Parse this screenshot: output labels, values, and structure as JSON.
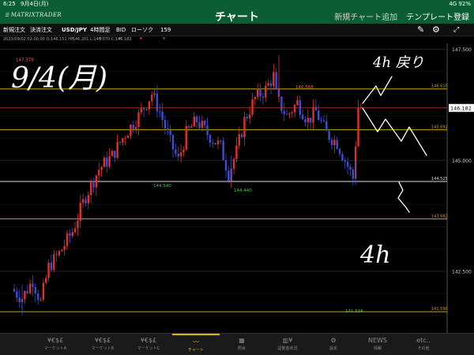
{
  "status": {
    "time": "6:25",
    "date": "9月4日(月)",
    "signal": "4G 92%"
  },
  "app": {
    "logo": "MATRIXTRADER",
    "title": "チャート",
    "add_chart": "新規チャート追加",
    "template": "テンプレート登録"
  },
  "toolbar": {
    "new_order": "新規注文",
    "settle_order": "決済注文",
    "pair": "USD/JPY",
    "timeframe": "4時間足",
    "side": "BID",
    "chart_type": "ローソク",
    "count": "159",
    "edit_icon": "pencil-icon",
    "settings_icon": "gear-icon"
  },
  "infobar": {
    "text": "2023/09/02 02:00:00  O:146.151  H:146.201  L:146.070  C:146.182"
  },
  "chart_data": {
    "type": "candlestick",
    "pair": "USD/JPY",
    "ylim": [
      141.2,
      147.6
    ],
    "yticks": [
      {
        "value": 147.5,
        "label": "147.500"
      },
      {
        "value": 145.0,
        "label": "145.000"
      },
      {
        "value": 142.5,
        "label": "142.500"
      }
    ],
    "current_price": {
      "value": 146.182,
      "label": "146.182"
    },
    "yellow_lines": [
      {
        "value": 146.61,
        "label": "146.610"
      },
      {
        "value": 145.692,
        "label": "145.692"
      },
      {
        "value": 143.682,
        "label": "143.682"
      },
      {
        "value": 141.59,
        "label": "141.590"
      }
    ],
    "white_line": {
      "value": 144.525,
      "label": "144.525"
    },
    "annotations": [
      {
        "label": "147.378",
        "value": 147.378,
        "color": "#ff5555"
      },
      {
        "label": "146.568",
        "value": 146.568,
        "color": "#ff5555"
      },
      {
        "label": "144.540",
        "value": 144.54,
        "color": "#3fcf3f"
      },
      {
        "label": "144.440",
        "value": 144.44,
        "color": "#3fcf3f"
      },
      {
        "label": "141.516",
        "value": 141.516,
        "color": "#3fcf3f"
      }
    ],
    "colors": {
      "up": "#e0302a",
      "down": "#3a4fd6",
      "yellow": "#c8a800",
      "bg": "#000000"
    }
  },
  "handwriting": {
    "date": "9/4(月)",
    "upper": "4h 戻り",
    "lower": "4h"
  },
  "tabs": [
    {
      "icon": "¥€$£",
      "label": "マーケットA"
    },
    {
      "icon": "¥€$£",
      "label": "マーケットB"
    },
    {
      "icon": "¥€$£",
      "label": "マーケットC"
    },
    {
      "icon": "〰",
      "label": "チャート"
    },
    {
      "icon": "▦",
      "label": "照会"
    },
    {
      "icon": "▥¥",
      "label": "証拠金状況"
    },
    {
      "icon": "⚙",
      "label": "設定"
    },
    {
      "icon": "NEWS",
      "label": "情報"
    },
    {
      "icon": "etc..",
      "label": "その他"
    }
  ]
}
